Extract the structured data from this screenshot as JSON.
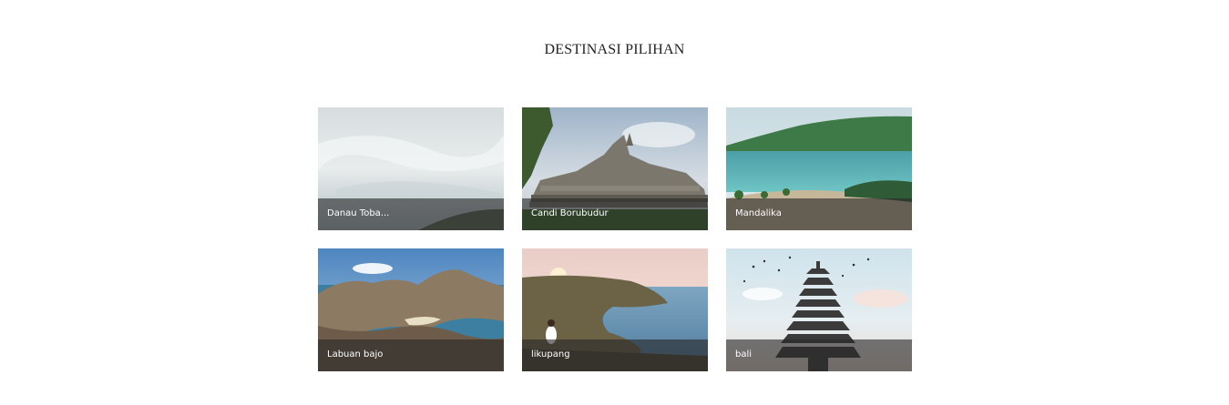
{
  "section": {
    "title": "DESTINASI PILIHAN"
  },
  "destinations": [
    {
      "label": "Danau Toba..."
    },
    {
      "label": "Candi Borubudur"
    },
    {
      "label": "Mandalika"
    },
    {
      "label": "Labuan bajo"
    },
    {
      "label": "likupang"
    },
    {
      "label": "bali"
    }
  ]
}
